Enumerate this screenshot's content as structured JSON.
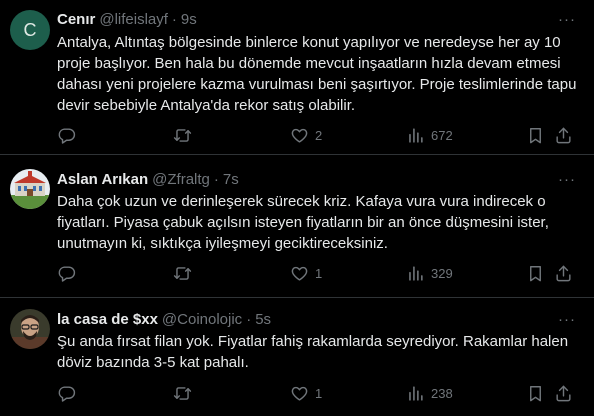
{
  "tweets": [
    {
      "avatar_letter": "C",
      "name": "Cenır",
      "handle": "@lifeislayf",
      "separator": "·",
      "time": "9s",
      "text": "Antalya, Altıntaş bölgesinde binlerce konut yapılıyor ve neredeyse her ay 10 proje başlıyor. Ben hala bu dönemde mevcut inşaatların hızla devam etmesi dahası yeni projelere kazma vurulması beni şaşırtıyor. Proje teslimlerinde tapu devir sebebiyle Antalya'da rekor satış olabilir.",
      "replies": "",
      "retweets": "",
      "likes": "2",
      "views": "672"
    },
    {
      "avatar_letter": "",
      "name": "Aslan Arıkan",
      "handle": "@Zfraltg",
      "separator": "·",
      "time": "7s",
      "text": "Daha çok uzun ve derinleşerek sürecek kriz. Kafaya vura vura indirecek o fiyatları. Piyasa çabuk açılsın isteyen fiyatların bir an önce düşmesini ister, unutmayın ki, sıktıkça iyileşmeyi geciktireceksiniz.",
      "replies": "",
      "retweets": "",
      "likes": "1",
      "views": "329"
    },
    {
      "avatar_letter": "",
      "name": "la casa de $xx",
      "handle": "@Coinolojic",
      "separator": "·",
      "time": "5s",
      "text": "Şu anda fırsat filan yok. Fiyatlar fahiş rakamlarda seyrediyor. Rakamlar halen döviz bazında 3-5 kat pahalı.",
      "replies": "",
      "retweets": "",
      "likes": "1",
      "views": "238"
    }
  ],
  "more_glyph": "···",
  "colors": {
    "background": "#000000",
    "text": "#e7e9ea",
    "muted": "#71767b",
    "divider": "#2f3336"
  },
  "icons": [
    "reply-icon",
    "retweet-icon",
    "like-icon",
    "views-icon",
    "bookmark-icon",
    "share-icon",
    "more-icon"
  ]
}
